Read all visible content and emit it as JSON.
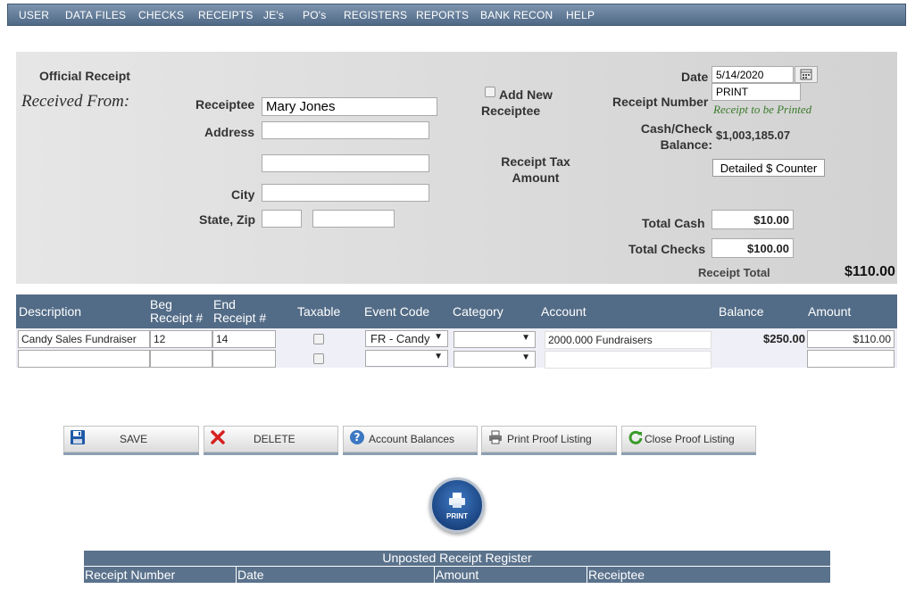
{
  "nav": [
    "USER",
    "DATA FILES",
    "CHECKS",
    "RECEIPTS",
    "JE's",
    "PO's",
    "REGISTERS",
    "REPORTS",
    "BANK RECON",
    "HELP"
  ],
  "form": {
    "official_receipt": "Official Receipt",
    "received_from": "Received From:",
    "receiptee_label": "Receiptee",
    "receiptee_value": "Mary Jones",
    "address_label": "Address",
    "address1_value": "",
    "address2_value": "",
    "city_label": "City",
    "city_value": "",
    "state_zip_label": "State, Zip",
    "state_value": "",
    "zip_value": "",
    "add_new_receiptee": "Add New Receiptee",
    "receipt_tax_amount": "Receipt Tax Amount",
    "date_label": "Date",
    "date_value": "5/14/2020",
    "receipt_number_label": "Receipt Number",
    "receipt_number_value": "PRINT",
    "receipt_to_be_printed": "Receipt to be Printed",
    "cash_check_balance_label": "Cash/Check Balance:",
    "cash_check_balance_value": "$1,003,185.07",
    "detailed_counter": "Detailed $ Counter",
    "total_cash_label": "Total Cash",
    "total_cash_value": "$10.00",
    "total_checks_label": "Total Checks",
    "total_checks_value": "$100.00",
    "receipt_total_label": "Receipt Total",
    "receipt_total_value": "$110.00"
  },
  "grid": {
    "headers": {
      "description": "Description",
      "beg_receipt_1": "Beg",
      "beg_receipt_2": "Receipt #",
      "end_receipt_1": "End",
      "end_receipt_2": "Receipt #",
      "taxable": "Taxable",
      "event_code": "Event Code",
      "category": "Category",
      "account": "Account",
      "balance": "Balance",
      "amount": "Amount"
    },
    "rows": [
      {
        "description": "Candy Sales Fundraiser",
        "beg": "12",
        "end": "14",
        "event_code": "FR - Candy",
        "category": "",
        "account": "2000.000 Fundraisers",
        "balance": "$250.00",
        "amount": "$110.00"
      },
      {
        "description": "",
        "beg": "",
        "end": "",
        "event_code": "",
        "category": "",
        "account": "",
        "balance": "",
        "amount": ""
      }
    ]
  },
  "actions": {
    "save": "SAVE",
    "delete": "DELETE",
    "account_balances": "Account Balances",
    "print_proof_listing": "Print Proof Listing",
    "close_proof_listing": "Close Proof Listing",
    "print": "PRINT"
  },
  "register": {
    "title": "Unposted Receipt Register",
    "columns": [
      "Receipt Number",
      "Date",
      "Amount",
      "Receiptee"
    ]
  },
  "colors": {
    "nav_bg": "#5f7995",
    "grid_header": "#526b86",
    "panel_bg": "#dcdcdc",
    "script_green": "#3a7a2a"
  }
}
